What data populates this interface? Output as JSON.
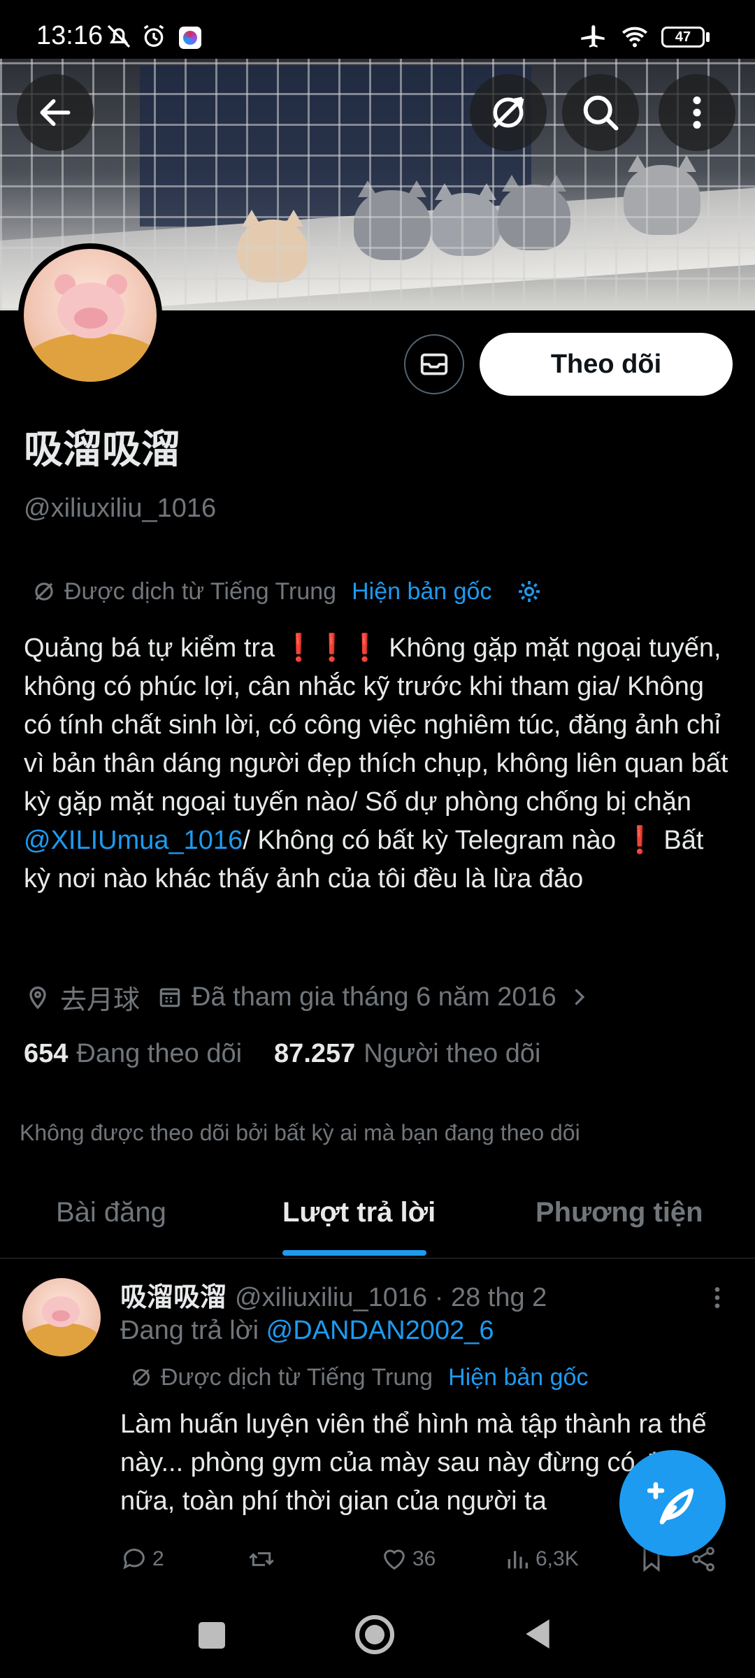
{
  "status_bar": {
    "time": "13:16",
    "battery": "47",
    "icons_left": [
      "bell-muted-icon",
      "alarm-icon",
      "app-notification-icon"
    ],
    "icons_right": [
      "airplane-icon",
      "wifi-icon",
      "battery-icon"
    ]
  },
  "banner": {
    "back_icon": "arrow-left-icon",
    "translate_icon": "translate-icon",
    "search_icon": "search-icon",
    "more_icon": "more-vertical-icon"
  },
  "profile": {
    "display_name": "吸溜吸溜",
    "handle": "@xiliuxiliu_1016",
    "follow_label": "Theo dõi",
    "message_icon": "mail-icon",
    "translated_from": "Được dịch từ Tiếng Trung",
    "show_original": "Hiện bản gốc",
    "bio": {
      "part1": "Quảng bá tự kiểm tra ",
      "bangs1": "❗❗❗",
      "part2": " Không gặp mặt ngoại tuyến, không có phúc lợi, cân nhắc kỹ trước khi tham gia/ Không có tính chất sinh lời, có công việc nghiêm túc, đăng ảnh chỉ vì bản thân dáng người đẹp thích chụp, không liên quan bất kỳ gặp mặt ngoại tuyến nào/ Số dự phòng chống bị chặn ",
      "mention": "@XILIUmua_1016",
      "part3": "/ Không có bất kỳ Telegram nào ",
      "bang2": "❗",
      "part4": " Bất kỳ nơi nào khác thấy ảnh của tôi đều là lừa đảo"
    },
    "location": "去月球",
    "joined": "Đã tham gia tháng 6 năm 2016",
    "following_count": "654",
    "following_label": "Đang theo dõi",
    "followers_count": "87.257",
    "followers_label": "Người theo dõi",
    "not_followed_text": "Không được theo dõi bởi bất kỳ ai mà bạn đang theo dõi"
  },
  "tabs": [
    {
      "label": "Bài đăng",
      "active": false
    },
    {
      "label": "Lượt trả lời",
      "active": true
    },
    {
      "label": "Phương tiện",
      "active": false
    }
  ],
  "post": {
    "name": "吸溜吸溜",
    "handle_date": "@xiliuxiliu_1016 · 28 thg 2",
    "replying_prefix": "Đang trả lời ",
    "replying_to": "@DANDAN2002_6",
    "translated_from": "Được dịch từ Tiếng Trung",
    "show_original": "Hiện bản gốc",
    "text": "Làm huấn luyện viên thể hình mà tập thành ra thế này... phòng gym của mày sau này đừng có đến nữa, toàn phí thời gian của người ta",
    "replies": "2",
    "retweets": "",
    "likes": "36",
    "views": "6,3K"
  },
  "fab_icon": "compose-post-icon",
  "nav": [
    "recent-apps-icon",
    "home-icon",
    "back-icon"
  ],
  "colors": {
    "accent": "#1d9bf0",
    "muted": "#71767b",
    "text": "#e7e9ea",
    "background": "#000000"
  }
}
